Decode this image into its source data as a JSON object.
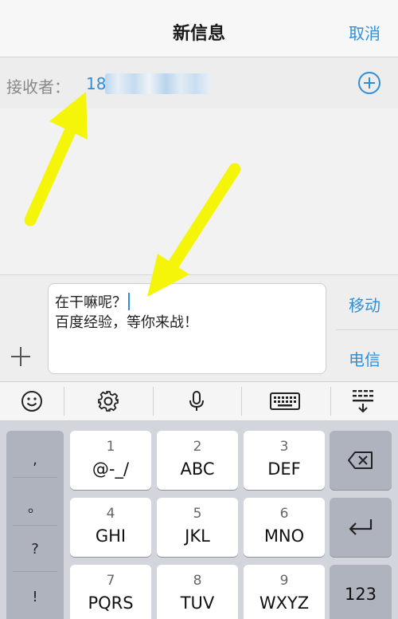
{
  "nav": {
    "title": "新信息",
    "cancel_label": "取消"
  },
  "recipient": {
    "label": "接收者：",
    "value_visible": "18"
  },
  "compose": {
    "message_line1": "在干嘛呢？",
    "message_line2": "百度经验，等你来战！",
    "carrier_1": "移动",
    "carrier_2": "电信"
  },
  "keyboard_toolbar": [
    "emoji-icon",
    "gear-icon",
    "microphone-icon",
    "keyboard-icon",
    "keyboard-collapse-icon"
  ],
  "punctuation": [
    ",",
    "。",
    "?",
    "!"
  ],
  "keys": [
    {
      "num": "1",
      "letters": "@-_/"
    },
    {
      "num": "2",
      "letters": "ABC"
    },
    {
      "num": "3",
      "letters": "DEF"
    },
    {
      "num": "4",
      "letters": "GHI"
    },
    {
      "num": "5",
      "letters": "JKL"
    },
    {
      "num": "6",
      "letters": "MNO"
    },
    {
      "num": "7",
      "letters": "PQRS"
    },
    {
      "num": "8",
      "letters": "TUV"
    },
    {
      "num": "9",
      "letters": "WXYZ"
    }
  ],
  "function_keys": {
    "numbers_label": "123"
  },
  "colors": {
    "accent": "#2f8fd9",
    "annotation_arrow": "#f5f50a",
    "keyboard_bg": "#d2d5db"
  }
}
